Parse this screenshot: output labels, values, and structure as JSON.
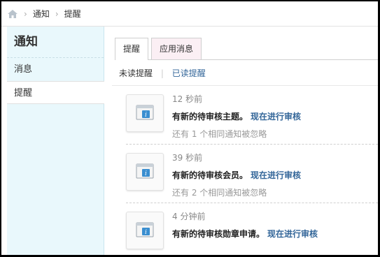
{
  "breadcrumb": {
    "home_icon": "home-icon",
    "items": [
      "通知",
      "提醒"
    ]
  },
  "sidebar": {
    "title": "通知",
    "items": [
      {
        "label": "消息",
        "active": false
      },
      {
        "label": "提醒",
        "active": true
      }
    ]
  },
  "tabs": [
    {
      "label": "提醒",
      "active": true
    },
    {
      "label": "应用消息",
      "active": false
    }
  ],
  "subnav": {
    "unread": "未读提醒",
    "read": "已读提醒"
  },
  "notices": [
    {
      "time": "12 秒前",
      "message": "有新的待审核主题。",
      "action": "现在进行审核",
      "ignored": "还有 1 个相同通知被忽略"
    },
    {
      "time": "39 秒前",
      "message": "有新的待审核会员。",
      "action": "现在进行审核",
      "ignored": "还有 2 个相同通知被忽略"
    },
    {
      "time": "4 分钟前",
      "message": "有新的待审核勋章申请。",
      "action": "现在进行审核",
      "ignored": ""
    }
  ],
  "colors": {
    "sidebar_bg": "#e9f8fc",
    "link": "#336699",
    "tab_inactive_bg": "#fbeff4",
    "info_icon": "#3a8ed0"
  }
}
